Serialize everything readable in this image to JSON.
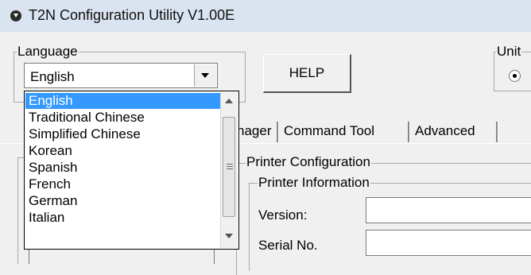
{
  "window": {
    "title": "T2N Configuration Utility V1.00E",
    "icon": "app-icon"
  },
  "language": {
    "legend": "Language",
    "selected": "English",
    "options": [
      "English",
      "Traditional Chinese",
      "Simplified Chinese",
      "Korean",
      "Spanish",
      "French",
      "German",
      "Italian"
    ]
  },
  "help_button": "HELP",
  "units": {
    "legend": "Unit"
  },
  "tabs": [
    {
      "label": "nager"
    },
    {
      "label": "Command Tool"
    },
    {
      "label": "Advanced"
    }
  ],
  "printer_config": {
    "legend": "Printer Configuration",
    "info_legend": "Printer Information",
    "version_label": "Version:",
    "version_value": "",
    "serial_label": "Serial No.",
    "serial_value": ""
  },
  "colors": {
    "selection": "#3399ff",
    "titlebar": "#dae3f0"
  }
}
